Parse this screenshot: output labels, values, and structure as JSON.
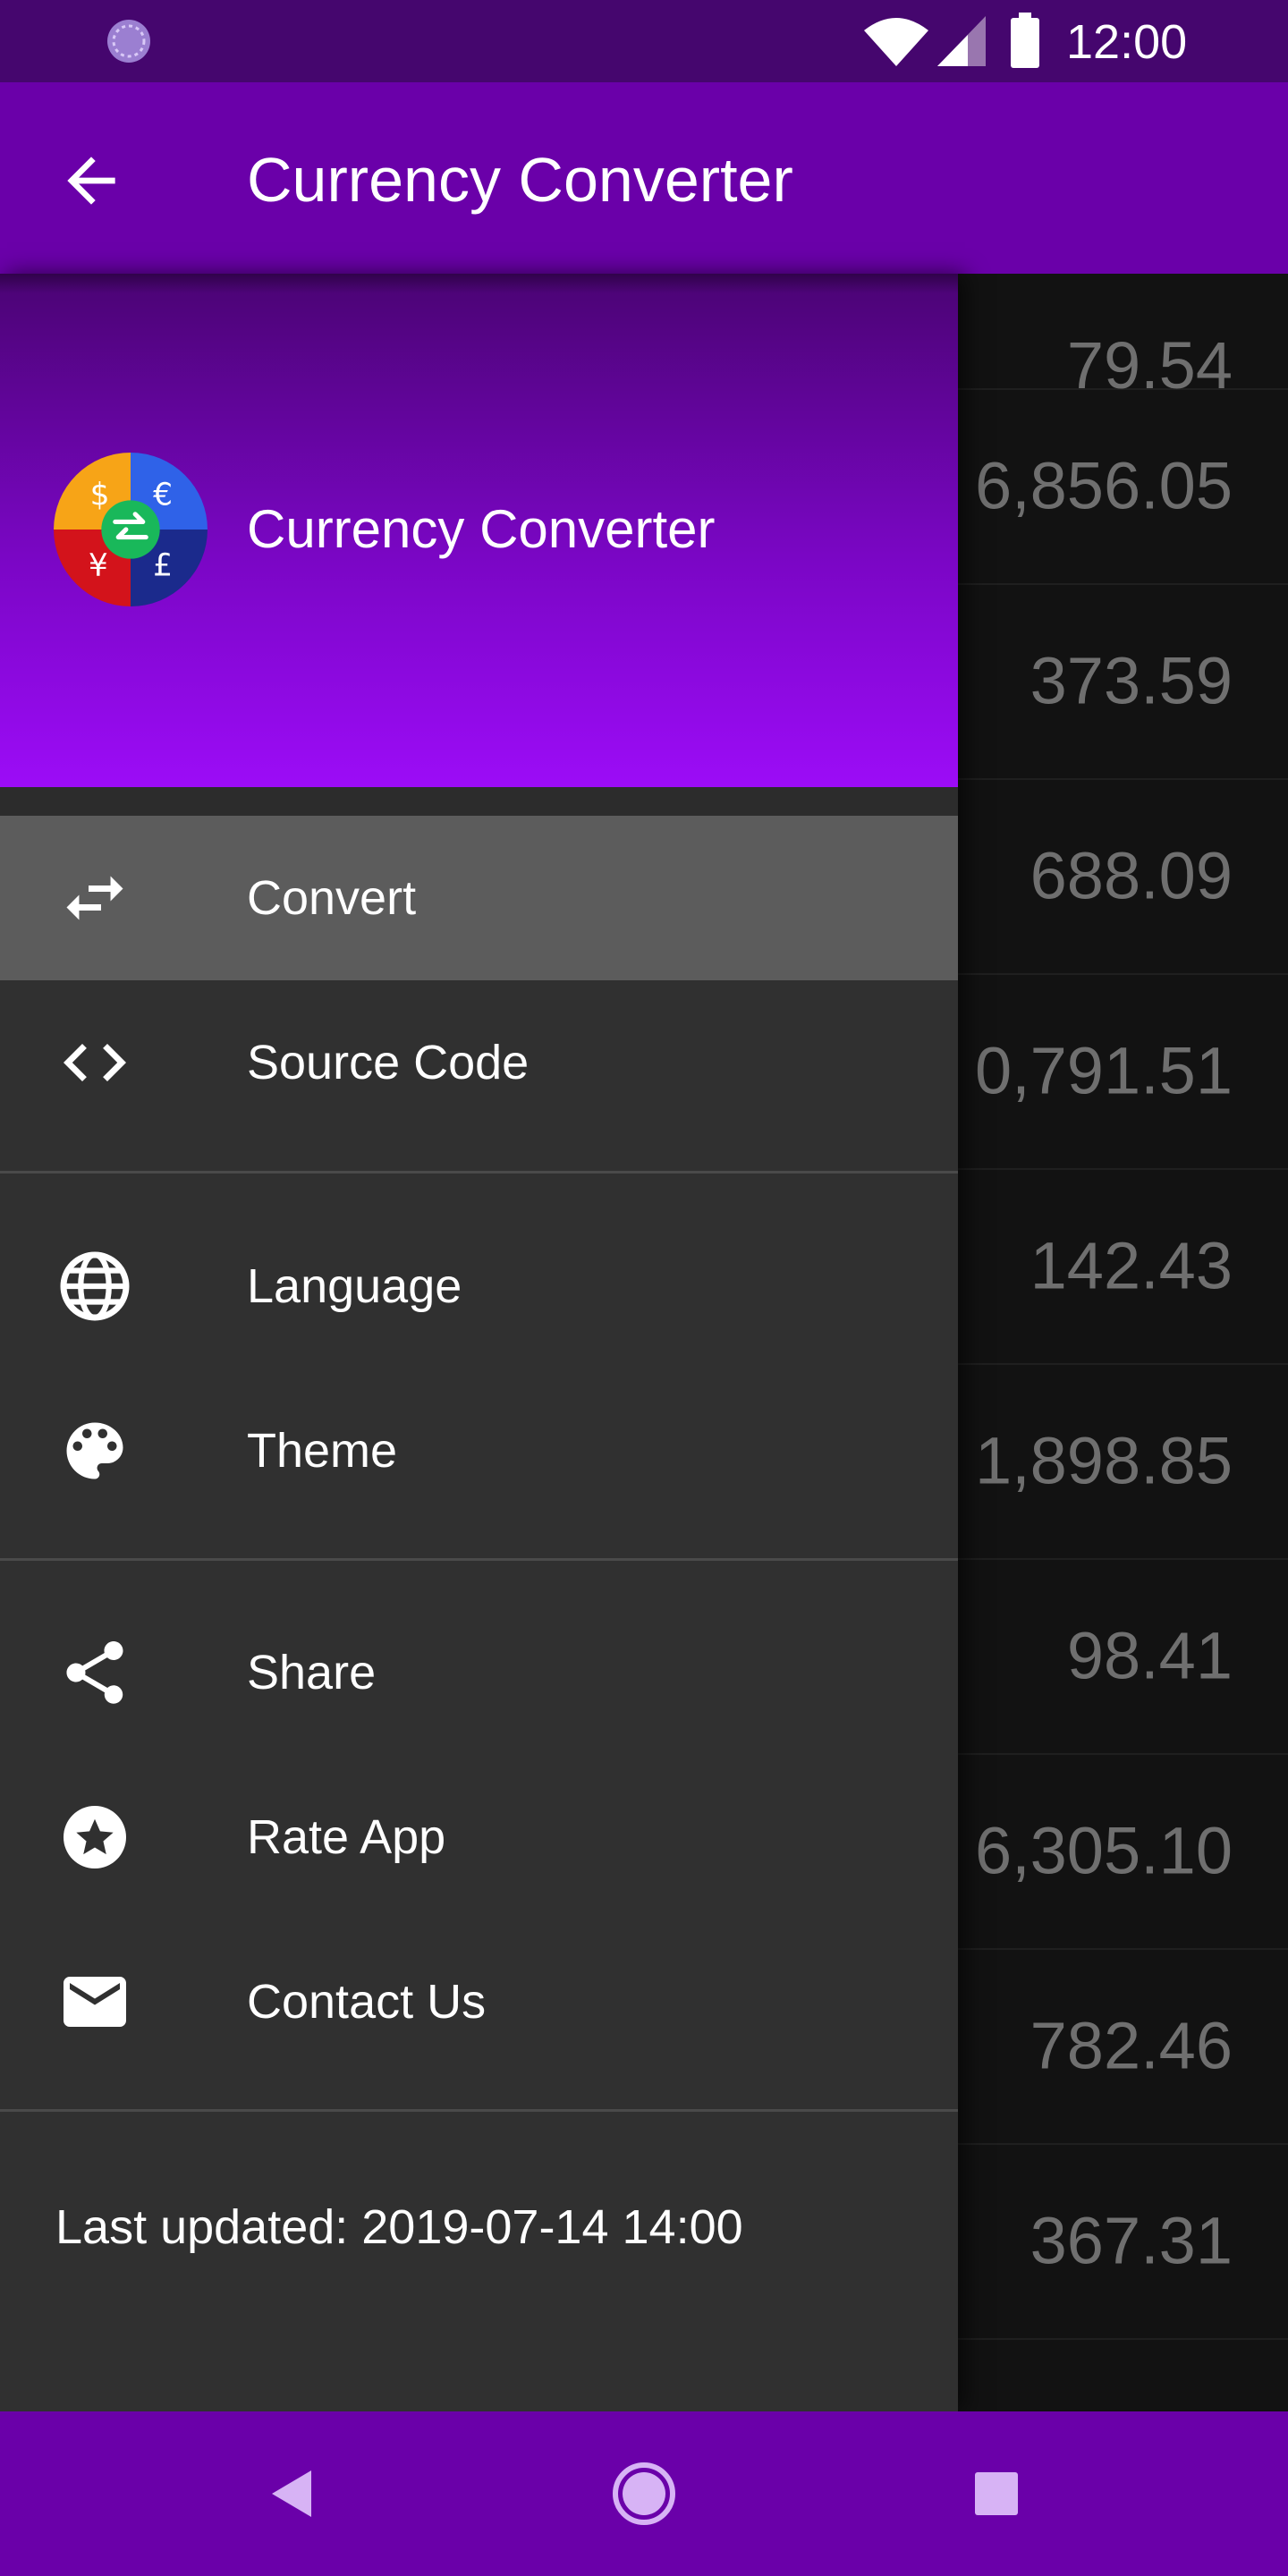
{
  "status_bar": {
    "time": "12:00",
    "icons": [
      "sync-icon",
      "wifi-icon",
      "signal-icon",
      "battery-icon"
    ]
  },
  "toolbar": {
    "title": "Currency Converter",
    "back_icon": "arrow-back-icon"
  },
  "drawer": {
    "header": {
      "app_name": "Currency Converter",
      "logo_icon": "currency-exchange-logo-icon"
    },
    "items": [
      {
        "label": "Convert",
        "icon": "swap-arrows-icon",
        "selected": true
      },
      {
        "label": "Source Code",
        "icon": "code-brackets-icon"
      },
      {
        "label": "Language",
        "icon": "globe-icon"
      },
      {
        "label": "Theme",
        "icon": "palette-icon"
      },
      {
        "label": "Share",
        "icon": "share-icon"
      },
      {
        "label": "Rate App",
        "icon": "star-badge-icon"
      },
      {
        "label": "Contact Us",
        "icon": "mail-icon"
      }
    ],
    "footer": "Last updated: 2019-07-14 14:00"
  },
  "content_list": {
    "values": [
      "79.54",
      "6,856.05",
      "373.59",
      "688.09",
      "0,791.51",
      "142.43",
      "1,898.85",
      "98.41",
      "6,305.10",
      "782.46",
      "367.31"
    ]
  },
  "nav_bar": {
    "buttons": [
      "back-nav-icon",
      "home-nav-icon",
      "recents-nav-icon"
    ]
  },
  "colors": {
    "primary": "#6a00a9",
    "primary_dark": "#45066e",
    "drawer_bg": "#303030",
    "selected_item": "#5c5c5c",
    "list_bg": "#121212"
  }
}
